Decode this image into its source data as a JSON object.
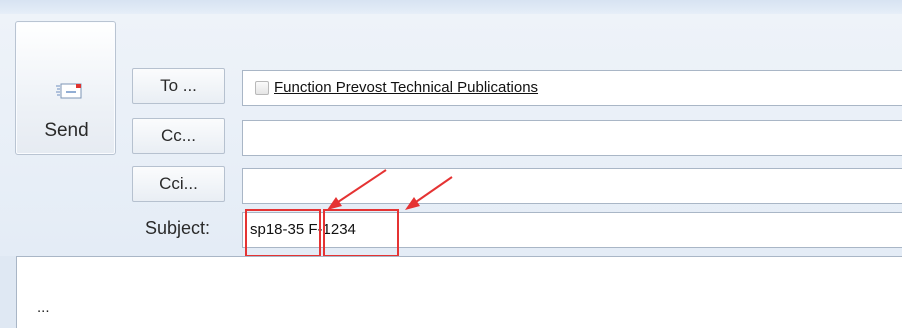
{
  "send": {
    "label": "Send",
    "icon": "envelope-send-icon"
  },
  "to": {
    "button_label": "To ...",
    "recipient": "Function Prevost Technical Publications",
    "recipient_icon": "contact-card-icon"
  },
  "cc": {
    "button_label": "Cc...",
    "value": ""
  },
  "bcc": {
    "button_label": "Cci...",
    "value": ""
  },
  "subject": {
    "label": "Subject:",
    "value": "sp18-35 F-1234"
  },
  "body": {
    "text": "..."
  },
  "annotations": {
    "color": "#e53333"
  }
}
